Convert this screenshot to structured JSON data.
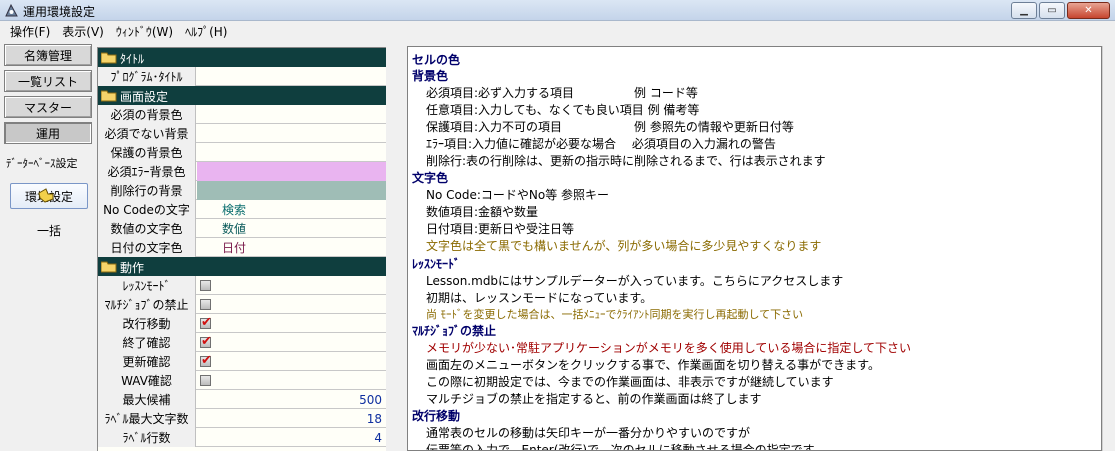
{
  "window": {
    "title": "運用環境設定"
  },
  "menu": [
    "操作(F)",
    "表示(V)",
    "ｳｨﾝﾄﾞｳ(W)",
    "ﾍﾙﾌﾟ(H)"
  ],
  "nav": {
    "buttons": [
      "名簿管理",
      "一覧リスト",
      "マスター",
      "運用"
    ],
    "label": "ﾃﾞｰﾀｰﾍﾞｰｽ設定",
    "sub_active": "環境設定",
    "sub_other": "一括"
  },
  "grid": {
    "sec_title": "ﾀｲﾄﾙ",
    "program_title": "ﾌﾟﾛｸﾞﾗﾑ･ﾀｲﾄﾙ",
    "sec_screen": "画面設定",
    "req_bg": "必須の背景色",
    "nonreq_bg": "必須でない背景",
    "protect_bg": "保護の背景色",
    "req_err_bg": "必須ｴﾗｰ背景色",
    "del_bg": "削除行の背景",
    "nocode_text": "No Codeの文字",
    "nocode_val": "検索",
    "num_text": "数値の文字色",
    "num_val": "数値",
    "date_text": "日付の文字色",
    "date_val": "日付",
    "sec_action": "動作",
    "lesson": "ﾚｯｽﾝﾓｰﾄﾞ",
    "multijob": "ﾏﾙﾁｼﾞｮﾌﾞの禁止",
    "newline": "改行移動",
    "exitconf": "終了確認",
    "updconf": "更新確認",
    "wavconf": "WAV確認",
    "maxcand": "最大候補",
    "maxcand_val": "500",
    "labelmax": "ﾗﾍﾞﾙ最大文字数",
    "labelmax_val": "18",
    "labelrows": "ﾗﾍﾞﾙ行数",
    "labelrows_val": "4"
  },
  "colors": {
    "req_err_bg": "#e9b4f0",
    "del_bg": "#9fbdb6",
    "section_bg": "#0f3e3e",
    "nocode": "#0a6e6e",
    "num": "#0a5a5a",
    "date": "#7a1a4a"
  },
  "help": {
    "l1": "セルの色",
    "l2": "背景色",
    "l3": "必須項目:必ず入力する項目　　　　　例  コード等",
    "l4": "任意項目:入力しても、なくても良い項目  例  備考等",
    "l5": "保護項目:入力不可の項目　　　　　　例  参照先の情報や更新日付等",
    "l6": "ｴﾗｰ項目:入力値に確認が必要な場合　 必須項目の入力漏れの警告",
    "l7": "削除行:表の行削除は、更新の指示時に削除されるまで、行は表示されます",
    "l8": "文字色",
    "l9": "No Code:コードやNo等  参照キー",
    "l10": "数値項目:金額や数量",
    "l11": "日付項目:更新日や受注日等",
    "l12": "文字色は全て黒でも構いませんが、列が多い場合に多少見やすくなります",
    "l13": "ﾚｯｽﾝﾓｰﾄﾞ",
    "l14": "Lesson.mdbにはサンプルデーターが入っています。こちらにアクセスします",
    "l15": "初期は、レッスンモードになっています。",
    "l16": "尚  ﾓｰﾄﾞを変更した場合は、一括ﾒﾆｭｰでｸﾗｲｱﾝﾄ同期を実行し再起動して下さい",
    "l17": "ﾏﾙﾁｼﾞｮﾌﾞの禁止",
    "l18": "メモリが少ない･常駐アプリケーションがメモリを多く使用している場合に指定して下さい",
    "l19": "画面左のメニューボタンをクリックする事で、作業画面を切り替える事ができます。",
    "l20": "この際に初期設定では、今までの作業画面は、非表示ですが継続しています",
    "l21": "マルチジョブの禁止を指定すると、前の作業画面は終了します",
    "l22": "改行移動",
    "l23": "通常表のセルの移動は矢印キーが一番分かりやすいのですが",
    "l24": "伝票等の入力で、Enter(改行)で、次のセルに移動させる場合の指定です"
  }
}
